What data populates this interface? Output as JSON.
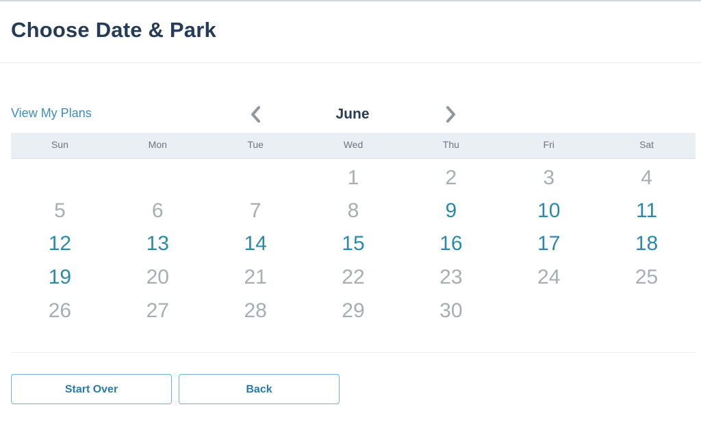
{
  "page": {
    "title": "Choose Date & Park"
  },
  "links": {
    "view_my_plans": "View My Plans"
  },
  "calendar": {
    "month": "June",
    "prev_icon": "chevron-left-icon",
    "next_icon": "chevron-right-icon",
    "weekdays": [
      "Sun",
      "Mon",
      "Tue",
      "Wed",
      "Thu",
      "Fri",
      "Sat"
    ],
    "weeks": [
      [
        null,
        null,
        null,
        {
          "day": "1",
          "available": false
        },
        {
          "day": "2",
          "available": false
        },
        {
          "day": "3",
          "available": false
        },
        {
          "day": "4",
          "available": false
        }
      ],
      [
        {
          "day": "5",
          "available": false
        },
        {
          "day": "6",
          "available": false
        },
        {
          "day": "7",
          "available": false
        },
        {
          "day": "8",
          "available": false
        },
        {
          "day": "9",
          "available": true
        },
        {
          "day": "10",
          "available": true
        },
        {
          "day": "11",
          "available": true
        }
      ],
      [
        {
          "day": "12",
          "available": true
        },
        {
          "day": "13",
          "available": true
        },
        {
          "day": "14",
          "available": true
        },
        {
          "day": "15",
          "available": true
        },
        {
          "day": "16",
          "available": true
        },
        {
          "day": "17",
          "available": true
        },
        {
          "day": "18",
          "available": true
        }
      ],
      [
        {
          "day": "19",
          "available": true
        },
        {
          "day": "20",
          "available": false
        },
        {
          "day": "21",
          "available": false
        },
        {
          "day": "22",
          "available": false
        },
        {
          "day": "23",
          "available": false
        },
        {
          "day": "24",
          "available": false
        },
        {
          "day": "25",
          "available": false
        }
      ],
      [
        {
          "day": "26",
          "available": false
        },
        {
          "day": "27",
          "available": false
        },
        {
          "day": "28",
          "available": false
        },
        {
          "day": "29",
          "available": false
        },
        {
          "day": "30",
          "available": false
        },
        null,
        null
      ]
    ]
  },
  "buttons": {
    "start_over": "Start Over",
    "back": "Back"
  },
  "colors": {
    "title": "#253b56",
    "link": "#3c8dbc",
    "available_day": "#2c8aa9",
    "disabled_day": "#a6aeb4",
    "weekday_bar": "#e9eff2",
    "button_border": "#6fb3d6"
  }
}
